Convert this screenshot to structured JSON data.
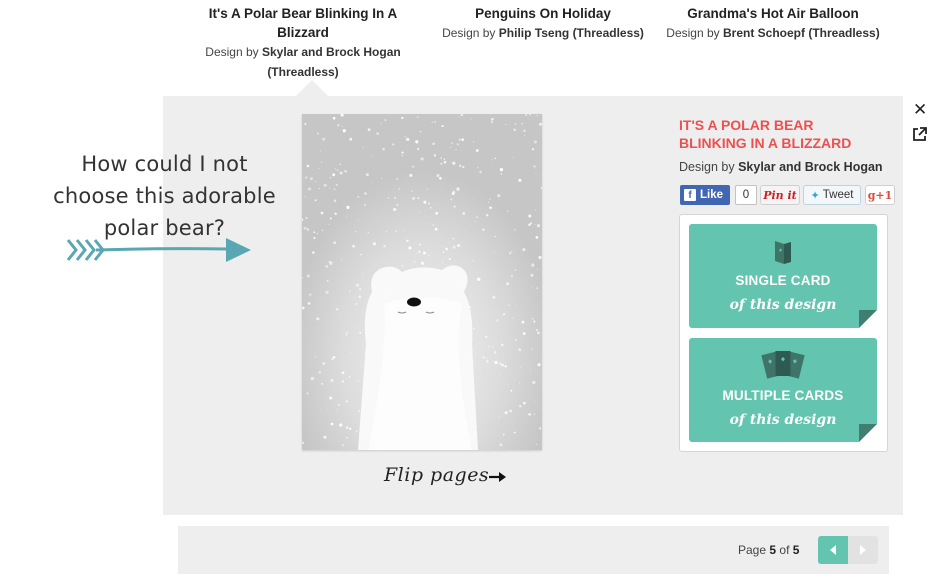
{
  "thumbnails": [
    {
      "title": "It's A Polar Bear Blinking In A Blizzard",
      "by_prefix": "Design by",
      "designer": "Skylar and Brock Hogan (Threadless)"
    },
    {
      "title": "Penguins On Holiday",
      "by_prefix": "Design by",
      "designer": "Philip Tseng (Threadless)"
    },
    {
      "title": "Grandma's Hot Air Balloon",
      "by_prefix": "Design by",
      "designer": "Brent Schoepf (Threadless)"
    }
  ],
  "annotation": {
    "text": "How could I not choose this adorable polar bear?"
  },
  "preview": {
    "flip_label": "Flip pages"
  },
  "detail": {
    "title": "It's A Polar Bear Blinking In A Blizzard",
    "by_prefix": "Design by",
    "designer": "Skylar and Brock Hogan"
  },
  "social": {
    "like": "Like",
    "like_count": "0",
    "pinit": "Pin it",
    "tweet": "Tweet",
    "gplus": "+1"
  },
  "options": [
    {
      "label": "SINGLE CARD",
      "sub": "of this design",
      "icon": "single-card-icon"
    },
    {
      "label": "MULTIPLE CARDS",
      "sub": "of this design",
      "icon": "multiple-cards-icon"
    }
  ],
  "pager": {
    "prefix": "Page",
    "current": "5",
    "of": "of",
    "total": "5"
  },
  "colors": {
    "accent": "#63c5b0",
    "title_red": "#ef4f4f",
    "panel": "#eeeeee",
    "annotation_arrow": "#5aa7b4"
  }
}
